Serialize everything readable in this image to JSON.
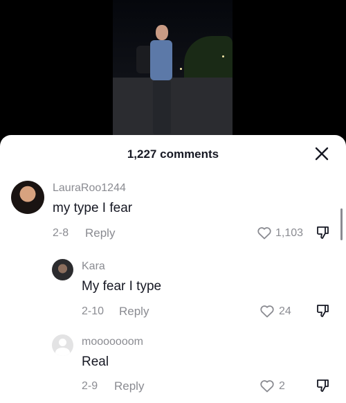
{
  "header": {
    "title": "1,227 comments"
  },
  "comments": [
    {
      "username": "LauraRoo1244",
      "text": "my type I fear",
      "date": "2-8",
      "reply_label": "Reply",
      "likes": "1,103"
    },
    {
      "username": "Kara",
      "text": "My fear I type",
      "date": "2-10",
      "reply_label": "Reply",
      "likes": "24"
    },
    {
      "username": "mooooooom",
      "text": "Real",
      "date": "2-9",
      "reply_label": "Reply",
      "likes": "2"
    }
  ],
  "icons": {
    "close": "close-icon",
    "like": "heart-icon",
    "dislike": "thumbs-down-icon"
  },
  "colors": {
    "text": "#161823",
    "muted": "#8a8b91",
    "sheet": "#ffffff",
    "background": "#000000"
  }
}
